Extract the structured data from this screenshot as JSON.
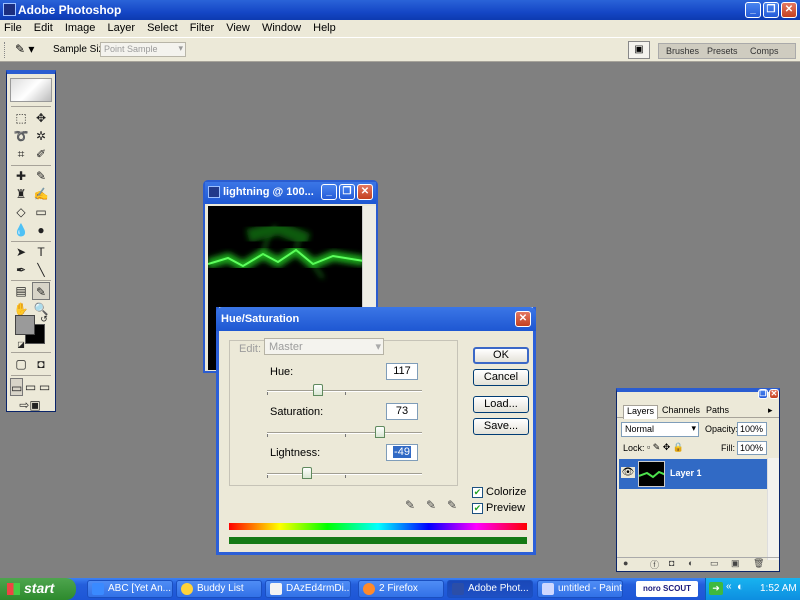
{
  "app": {
    "title": "Adobe Photoshop",
    "window_buttons": [
      "_",
      "❐",
      "✕"
    ]
  },
  "menu": [
    "File",
    "Edit",
    "Image",
    "Layer",
    "Select",
    "Filter",
    "View",
    "Window",
    "Help"
  ],
  "options_bar": {
    "tool_icon": "eyedropper-icon",
    "sample_size_label": "Sample Size:",
    "sample_size_value": "Point Sample",
    "palette_wells": [
      "Brushes",
      "Presets",
      "Comps"
    ]
  },
  "document": {
    "title": "lightning @ 100..."
  },
  "hue_saturation": {
    "title": "Hue/Saturation",
    "edit_label": "Edit:",
    "edit_value": "Master",
    "hue_label": "Hue:",
    "hue_value": "117",
    "saturation_label": "Saturation:",
    "saturation_value": "73",
    "lightness_label": "Lightness:",
    "lightness_value": "-49",
    "hue_fraction": 0.33,
    "saturation_fraction": 0.73,
    "lightness_fraction": 0.255,
    "buttons": {
      "ok": "OK",
      "cancel": "Cancel",
      "load": "Load...",
      "save": "Save..."
    },
    "colorize_label": "Colorize",
    "colorize_checked": true,
    "preview_label": "Preview",
    "preview_checked": true
  },
  "layers_palette": {
    "tabs": [
      "Layers",
      "Channels",
      "Paths"
    ],
    "blend_mode": "Normal",
    "opacity_label": "Opacity:",
    "opacity_value": "100%",
    "lock_label": "Lock:",
    "fill_label": "Fill:",
    "fill_value": "100%",
    "layer_name": "Layer 1"
  },
  "taskbar": {
    "start_label": "start",
    "items": [
      "ABC [Yet An...",
      "Buddy List",
      "DAzEd4rmDi...",
      "2 Firefox",
      "Adobe Phot...",
      "untitled - Paint"
    ],
    "tray_badge": "noro SCOUT",
    "clock": "1:52 AM"
  },
  "colors": {
    "xp_blue": "#2a5cd0",
    "panel": "#ece9d8",
    "workspace": "#808080",
    "lightning_green": "#37e437"
  }
}
